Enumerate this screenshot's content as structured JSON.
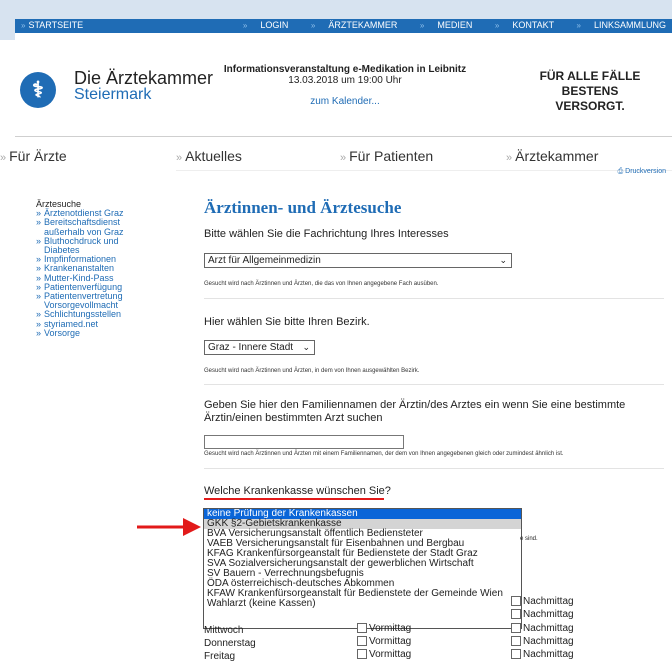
{
  "topnav": {
    "home": "STARTSEITE",
    "items": [
      "LOGIN",
      "ÄRZTEKAMMER",
      "MEDIEN",
      "KONTAKT",
      "LINKSAMMLUNG"
    ]
  },
  "logo": {
    "line1": "Die Ärztekammer",
    "line2": "Steiermark"
  },
  "event": {
    "title": "Informationsveranstaltung e-Medikation in Leibnitz",
    "date": "13.03.2018 um 19:00 Uhr",
    "link": "zum Kalender..."
  },
  "slogan": {
    "line1": "FÜR ALLE FÄLLE",
    "line2": "BESTENS VERSORGT."
  },
  "mainnav": [
    "Für Ärzte",
    "Aktuelles",
    "Für Patienten",
    "Ärztekammer"
  ],
  "print_label": "Druckversion",
  "sidebar": {
    "header": "Ärztesuche",
    "items": [
      "Ärztenotdienst Graz",
      "Bereitschaftsdienst außerhalb von Graz",
      "Bluthochdruck und Diabetes",
      "Impfinformationen",
      "Krankenanstalten",
      "Mutter-Kind-Pass",
      "Patientenverfügung",
      "Patientenvertretung Vorsorgevollmacht",
      "Schlichtungsstellen",
      "styriamed.net",
      "Vorsorge"
    ]
  },
  "main": {
    "title": "Ärztinnen- und Ärztesuche",
    "q1": "Bitte wählen Sie die Fachrichtung Ihres Interesses",
    "q1_value": "Arzt für Allgemeinmedizin",
    "q1_hint": "Gesucht wird nach Ärztinnen und Ärzten, die das von Ihnen angegebene Fach ausüben.",
    "q2": "Hier wählen Sie bitte Ihren Bezirk.",
    "q2_value": "Graz - Innere Stadt",
    "q2_hint": "Gesucht wird nach Ärztinnen und Ärzten, in dem von Ihnen ausgewählten Bezirk.",
    "q3": "Geben Sie hier den Familiennamen der Ärztin/des Arztes ein wenn Sie eine bestimmte Ärztin/einen bestimmten Arzt suchen",
    "q3_hint": "Gesucht wird nach Ärztinnen und Ärzten mit einem Familiennamen, der dem von Ihnen angegebenen gleich oder zumindest ähnlich ist.",
    "q4": "Welche Krankenkasse wünschen Sie?",
    "q4_tail": "e sind.",
    "kassen": [
      "keine Prüfung der Krankenkassen",
      "GKK §2-Gebietskrankenkasse",
      "BVA Versicherungsanstalt öffentlich Bediensteter",
      "VAEB Versicherungsanstalt für Eisenbahnen und Bergbau",
      "KFAG Krankenfürsorgeanstalt für Bedienstete der Stadt Graz",
      "SVA Sozialversicherungsanstalt der gewerblichen Wirtschaft",
      "SV Bauern - Verrechnungsbefugnis",
      "ÖDA österreichisch-deutsches Abkommen",
      "KFAW Krankenfürsorgeanstalt für Bedienstete der Gemeinde Wien",
      "Wahlarzt (keine Kassen)"
    ],
    "days": [
      {
        "day": "Mittwoch",
        "am": "Vormittag",
        "pm": "Nachmittag"
      },
      {
        "day": "Donnerstag",
        "am": "Vormittag",
        "pm": "Nachmittag"
      },
      {
        "day": "Freitag",
        "am": "Vormittag",
        "pm": "Nachmittag"
      }
    ],
    "pm_extra": [
      "Nachmittag",
      "Nachmittag"
    ]
  }
}
